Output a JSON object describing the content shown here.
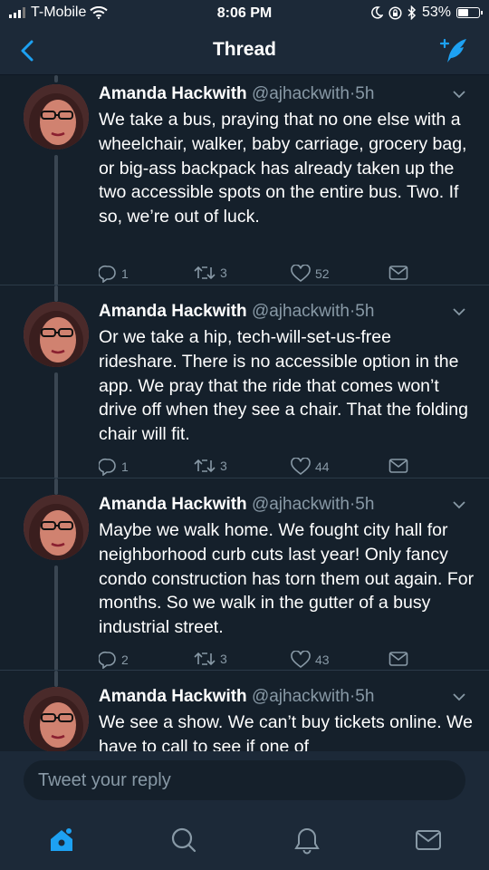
{
  "status_bar": {
    "carrier": "T-Mobile",
    "time": "8:06 PM",
    "battery": "53%",
    "battery_level": 0.53
  },
  "nav": {
    "title": "Thread",
    "back_icon": "chevron-left-icon",
    "compose_icon": "compose-tweet-icon"
  },
  "tweets": [
    {
      "name": "Amanda Hackwith",
      "handle": "@ajhackwith",
      "separator": "·",
      "time": "5h",
      "text": "We take a bus, praying that no one else with a wheelchair, walker, baby carriage, grocery bag, or big-ass backpack has already taken up the two accessible spots on the entire bus. Two. If so, we’re out of luck.",
      "replies": "1",
      "retweets": "3",
      "likes": "52"
    },
    {
      "name": "Amanda Hackwith",
      "handle": "@ajhackwith",
      "separator": "·",
      "time": "5h",
      "text": "Or we take a hip, tech-will-set-us-free rideshare. There is no accessible option in the app. We pray that the ride that comes won’t drive off when they see a chair. That the folding chair will fit.",
      "replies": "1",
      "retweets": "3",
      "likes": "44"
    },
    {
      "name": "Amanda Hackwith",
      "handle": "@ajhackwith",
      "separator": "·",
      "time": "5h",
      "text": "Maybe we walk home. We fought city hall for neighborhood curb cuts last year! Only fancy condo construction has torn them out again. For months. So we walk in the gutter of a busy industrial street.",
      "replies": "2",
      "retweets": "3",
      "likes": "43"
    },
    {
      "name": "Amanda Hackwith",
      "handle": "@ajhackwith",
      "separator": "·",
      "time": "5h",
      "text": "We see a show. We can’t buy tickets online. We have to call to see if one of"
    }
  ],
  "reply": {
    "placeholder": "Tweet your reply"
  },
  "tabs": [
    {
      "icon": "home-icon",
      "active": true
    },
    {
      "icon": "search-icon",
      "active": false
    },
    {
      "icon": "notifications-bell-icon",
      "active": false
    },
    {
      "icon": "messages-envelope-icon",
      "active": false
    }
  ],
  "colors": {
    "background": "#15202b",
    "bars": "#1c2938",
    "accent": "#1da1f2",
    "secondary_text": "#8899a6"
  }
}
